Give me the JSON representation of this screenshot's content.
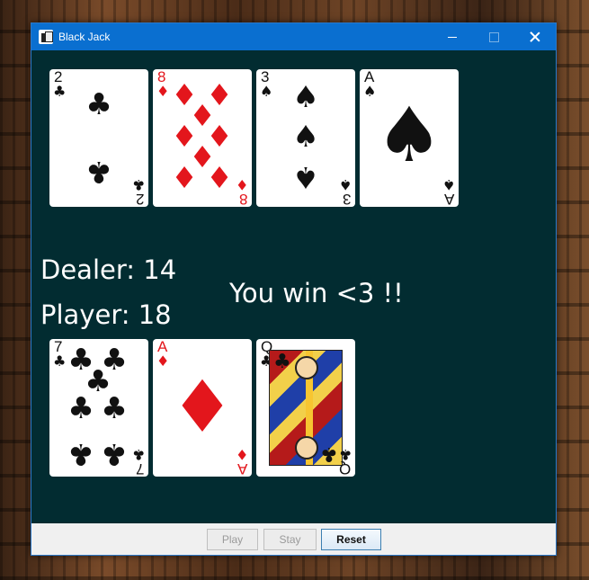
{
  "window": {
    "title": "Black Jack"
  },
  "dealer": {
    "label": "Dealer: 14",
    "cards": [
      {
        "rank": "2",
        "suit": "♣",
        "color": "black"
      },
      {
        "rank": "8",
        "suit": "♦",
        "color": "red"
      },
      {
        "rank": "3",
        "suit": "♠",
        "color": "black"
      },
      {
        "rank": "A",
        "suit": "♠",
        "color": "black"
      }
    ]
  },
  "player": {
    "label": "Player: 18",
    "cards": [
      {
        "rank": "7",
        "suit": "♣",
        "color": "black"
      },
      {
        "rank": "A",
        "suit": "♦",
        "color": "red"
      },
      {
        "rank": "Q",
        "suit": "♣",
        "color": "black"
      }
    ]
  },
  "result_text": "You win <3 !!",
  "buttons": {
    "play": "Play",
    "stay": "Stay",
    "reset": "Reset"
  },
  "colors": {
    "table": "#022c31",
    "titlebar": "#0a6fd0",
    "red_suit": "#e3161c"
  }
}
